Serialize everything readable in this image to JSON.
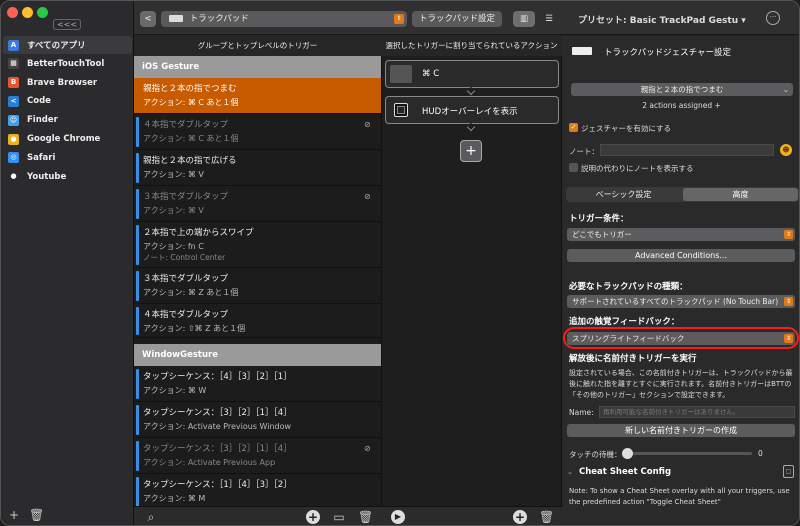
{
  "sidebar": {
    "collapse_label": "<<<",
    "apps": [
      {
        "label": "すべてのアプリ",
        "color": "#3a7be0",
        "glyph": "A"
      },
      {
        "label": "BetterTouchTool",
        "color": "#444",
        "glyph": "▦"
      },
      {
        "label": "Brave Browser",
        "color": "#e8542b",
        "glyph": "B"
      },
      {
        "label": "Code",
        "color": "#2a7fd4",
        "glyph": "<"
      },
      {
        "label": "Finder",
        "color": "#3ea0ef",
        "glyph": "☺"
      },
      {
        "label": "Google Chrome",
        "color": "#e8b21e",
        "glyph": "●"
      },
      {
        "label": "Safari",
        "color": "#3a8ef0",
        "glyph": "◎"
      },
      {
        "label": "Youtube",
        "color": "#ffffff",
        "glyph": "●"
      }
    ]
  },
  "toolbar": {
    "back_label": "<",
    "device_select": "トラックパッド",
    "settings_button": "トラックパッド設定",
    "preset_label": "プリセット: Basic TrackPad Gestu",
    "more_label": "···"
  },
  "columns": {
    "triggers_header": "グループとトップレベルのトリガー",
    "actions_header": "選択したトリガーに割り当てられているアクション"
  },
  "groups": [
    {
      "label": "iOS Gesture"
    },
    {
      "label": "WindowGesture"
    }
  ],
  "triggers_ios": [
    {
      "title": "親指と２本の指でつまむ",
      "action": "アクション: ⌘ C あと１個",
      "note": "",
      "selected": true,
      "disabled": false
    },
    {
      "title": "４本指でダブルタップ",
      "action": "アクション: ⌘ C あと１個",
      "note": "",
      "selected": false,
      "disabled": true
    },
    {
      "title": "親指と２本の指で広げる",
      "action": "アクション: ⌘ V",
      "note": "",
      "selected": false,
      "disabled": false
    },
    {
      "title": "３本指でダブルタップ",
      "action": "アクション: ⌘ V",
      "note": "",
      "selected": false,
      "disabled": true
    },
    {
      "title": "２本指で上の端からスワイプ",
      "action": "アクション: fn  C",
      "note": "ノート: Control Center",
      "selected": false,
      "disabled": false
    },
    {
      "title": "３本指でダブルタップ",
      "action": "アクション: ⌘ Z あと１個",
      "note": "",
      "selected": false,
      "disabled": false
    },
    {
      "title": "４本指でダブルタップ",
      "action": "アクション: ⇧⌘ Z あと１個",
      "note": "",
      "selected": false,
      "disabled": false
    }
  ],
  "triggers_window": [
    {
      "title": "タップシーケンス：［4］［3］［2］［1］",
      "action": "アクション: ⌘ W",
      "disabled": false
    },
    {
      "title": "タップシーケンス：［3］［2］［1］［4］",
      "action": "アクション: Activate Previous Window",
      "disabled": false
    },
    {
      "title": "タップシーケンス：［3］［2］［1］［4］",
      "action": "アクション: Activate Previous App",
      "disabled": true
    },
    {
      "title": "タップシーケンス：［1］［4］［3］［2］",
      "action": "アクション: ⌘ M",
      "disabled": false
    }
  ],
  "actions": [
    {
      "label": "⌘ C"
    },
    {
      "label": "HUDオーバーレイを表示"
    }
  ],
  "add_action_label": "+",
  "panel": {
    "title": "トラックパッドジェスチャー設定",
    "gesture_select": "親指と２本の指でつまむ",
    "assigned_text": "2 actions assigned +",
    "enable_label": "ジェスチャーを有効にする",
    "note_label": "ノート：",
    "note_value": "",
    "show_note_label": "説明の代わりにノートを表示する",
    "tab_basic": "ベーシック設定",
    "tab_advanced": "高度",
    "trigger_condition_label": "トリガー条件：",
    "trigger_condition_value": "どこでもトリガー",
    "advanced_conditions_button": "Advanced Conditions...",
    "required_type_label": "必要なトラックパッドの種類：",
    "required_type_value": "サポートされているすべてのトラックパッド (No Touch Bar)",
    "haptic_label": "追加の触覚フィードバック：",
    "haptic_value": "スプリングライトフィードバック",
    "named_trigger_label": "解放後に名前付きトリガーを実行",
    "named_trigger_desc": "設定されている場合、この名前付きトリガーは、トラックパッドから最後に触れた指を離すとすぐに実行されます。名前付きトリガーはBTTの「その他のトリガー」セクションで設定できます。",
    "name_label": "Name:",
    "name_placeholder": "再利用可能な名前付きトリガーはありません。",
    "new_named_trigger_button": "新しい名前付きトリガーの作成",
    "touch_wait_label": "タッチの待機：",
    "touch_wait_value": "0",
    "touch_wait_fraction": 0,
    "cheat_sheet_label": "Cheat Sheet Config",
    "cheat_sheet_note": "Note: To show a Cheat Sheet overlay with all your triggers, use the predefined action \"Toggle Cheat Sheet\""
  },
  "colors": {
    "accent": "#c85a00",
    "highlight_ring": "#ff1a1a"
  }
}
